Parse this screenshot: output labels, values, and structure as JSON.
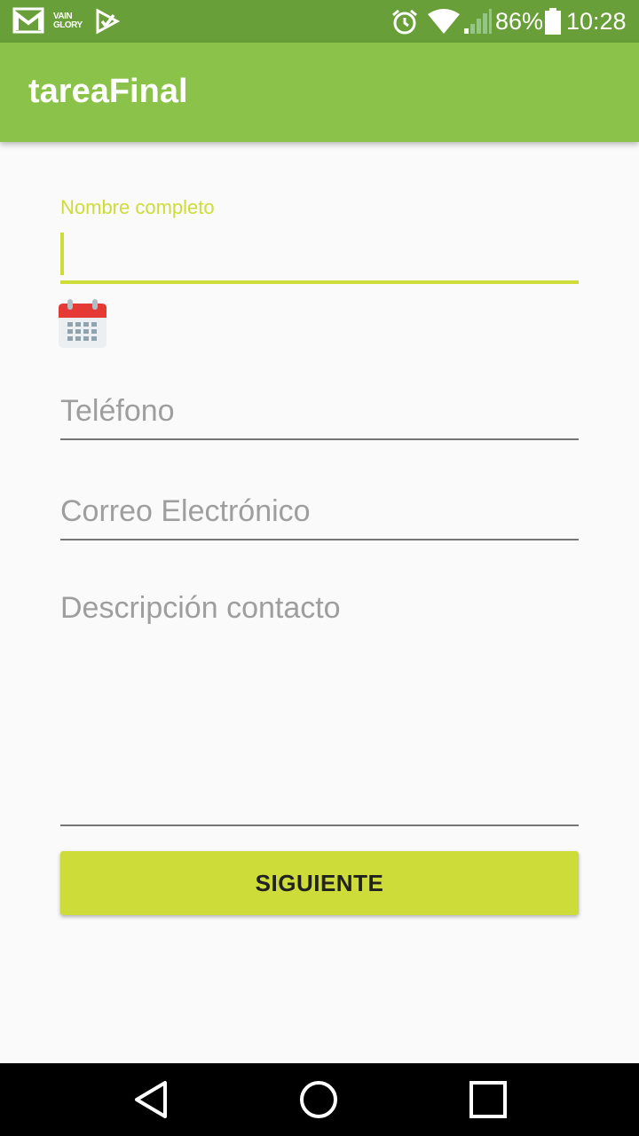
{
  "status_bar": {
    "notification_icons": [
      "gmail-icon",
      "vainglory-icon",
      "play-store-icon"
    ],
    "vainglory_text": [
      "VAIN",
      "GLORY"
    ],
    "alarm_icon": "alarm-icon",
    "wifi_icon": "wifi-icon",
    "signal_icon": "signal-icon",
    "battery_percent": "86%",
    "battery_level": 0.86,
    "time": "10:28"
  },
  "app_bar": {
    "title": "tareaFinal",
    "color": "#8BC34A"
  },
  "form": {
    "name_field": {
      "label": "Nombre completo",
      "value": ""
    },
    "date_button_icon": "calendar-icon",
    "phone_field": {
      "placeholder": "Teléfono"
    },
    "email_field": {
      "placeholder": "Correo Electrónico"
    },
    "description_field": {
      "placeholder": "Descripción contacto"
    },
    "accent_color": "#CDDC39"
  },
  "button": {
    "label": "SIGUIENTE"
  },
  "nav_bar": {
    "back_icon": "back-icon",
    "home_icon": "home-icon",
    "recents_icon": "recents-icon"
  }
}
